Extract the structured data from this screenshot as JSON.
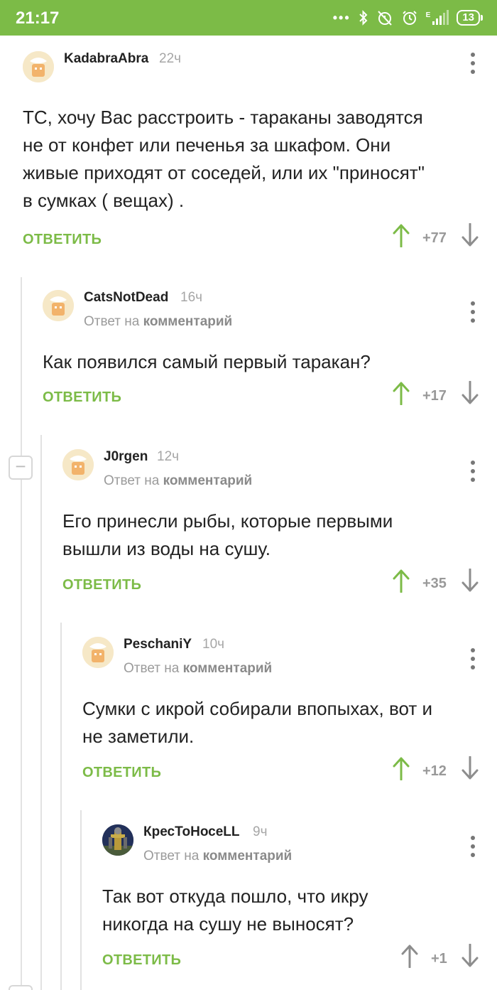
{
  "status_bar": {
    "time": "21:17",
    "battery": "13",
    "network": "E"
  },
  "comments": [
    {
      "username": "KadabraAbra",
      "time": "22ч",
      "text_lines": [
        "ТС, хочу Вас расстроить - тараканы заводятся",
        "не от конфет или печенья за шкафом. Они",
        "живые приходят от соседей, или их \"приносят\"",
        "в сумках ( вещах) ."
      ],
      "reply_label": "ОТВЕТИТЬ",
      "score": "+77"
    },
    {
      "username": "CatsNotDead",
      "time": "16ч",
      "reply_prefix": "Ответ на",
      "reply_target": "комментарий",
      "text_lines": [
        "Как появился самый первый таракан?"
      ],
      "reply_label": "ОТВЕТИТЬ",
      "score": "+17"
    },
    {
      "username": "J0rgen",
      "time": "12ч",
      "reply_prefix": "Ответ на",
      "reply_target": "комментарий",
      "text_lines": [
        "Его принесли рыбы, которые первыми",
        "вышли из воды на сушу."
      ],
      "reply_label": "ОТВЕТИТЬ",
      "score": "+35"
    },
    {
      "username": "PeschaniY",
      "time": "10ч",
      "reply_prefix": "Ответ на",
      "reply_target": "комментарий",
      "text_lines": [
        "Сумки с икрой собирали впопыхах, вот и",
        "не заметили."
      ],
      "reply_label": "ОТВЕТИТЬ",
      "score": "+12"
    },
    {
      "username": "КресТоНосеLL",
      "time": "9ч",
      "reply_prefix": "Ответ на",
      "reply_target": "комментарий",
      "text_lines": [
        "Так вот откуда пошло, что икру",
        "никогда на сушу не выносят?"
      ],
      "reply_label": "ОТВЕТИТЬ",
      "score": "+1"
    }
  ],
  "colors": {
    "accent_green": "#7cbb47",
    "vote_up_green": "#7cbb47",
    "vote_neutral": "#8d8d8d",
    "muted_text": "#9b9b9b"
  },
  "icons": {
    "collapse": "minus-icon",
    "menu": "kebab-menu-icon",
    "upvote": "arrow-up-icon",
    "downvote": "arrow-down-icon"
  }
}
